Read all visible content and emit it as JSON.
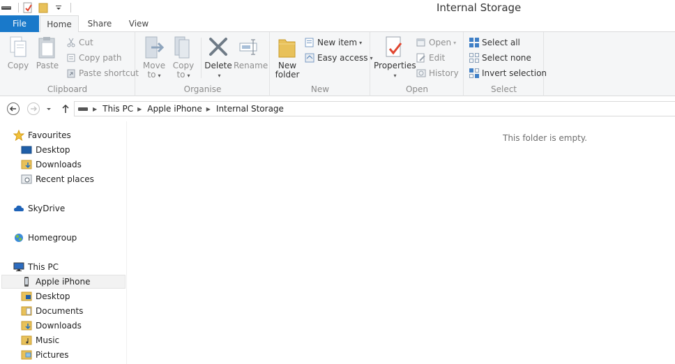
{
  "window": {
    "title": "Internal Storage"
  },
  "tabs": {
    "file": "File",
    "home": "Home",
    "share": "Share",
    "view": "View"
  },
  "ribbon": {
    "clipboard": {
      "label": "Clipboard",
      "copy": "Copy",
      "paste": "Paste",
      "cut": "Cut",
      "copy_path": "Copy path",
      "paste_shortcut": "Paste shortcut"
    },
    "organise": {
      "label": "Organise",
      "move_to_1": "Move",
      "move_to_2": "to",
      "copy_to_1": "Copy",
      "copy_to_2": "to",
      "delete": "Delete",
      "rename": "Rename"
    },
    "new": {
      "label": "New",
      "new_folder_1": "New",
      "new_folder_2": "folder",
      "new_item": "New item",
      "easy_access": "Easy access"
    },
    "open": {
      "label": "Open",
      "properties": "Properties",
      "open": "Open",
      "edit": "Edit",
      "history": "History"
    },
    "select": {
      "label": "Select",
      "select_all": "Select all",
      "select_none": "Select none",
      "invert_selection": "Invert selection"
    }
  },
  "address": {
    "crumbs": [
      "This PC",
      "Apple iPhone",
      "Internal Storage"
    ]
  },
  "nav": {
    "favourites": "Favourites",
    "desktop": "Desktop",
    "downloads": "Downloads",
    "recent_places": "Recent places",
    "skydrive": "SkyDrive",
    "homegroup": "Homegroup",
    "this_pc": "This PC",
    "apple_iphone": "Apple iPhone",
    "pc_desktop": "Desktop",
    "documents": "Documents",
    "pc_downloads": "Downloads",
    "music": "Music",
    "pictures": "Pictures"
  },
  "content": {
    "empty_message": "This folder is empty."
  },
  "colors": {
    "file_tab": "#1979ca",
    "ribbon_bg": "#f5f6f7",
    "folder": "#e8c15a"
  }
}
